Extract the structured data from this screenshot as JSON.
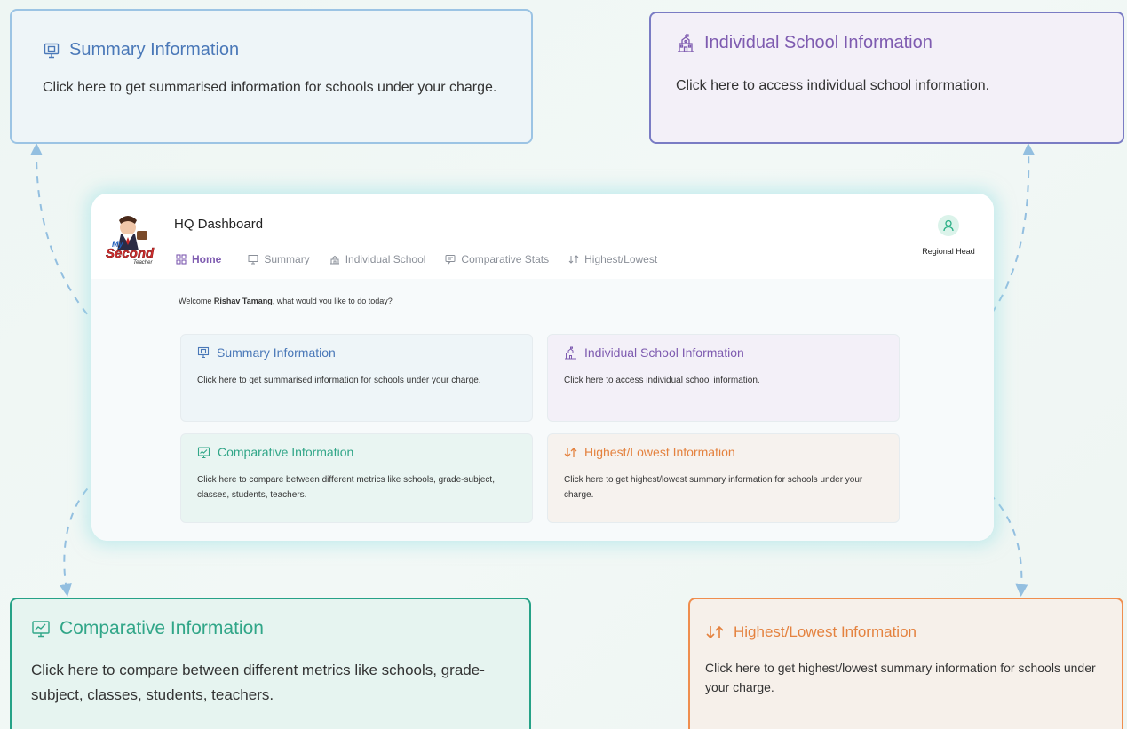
{
  "callouts": {
    "summary": {
      "icon": "monitor-icon",
      "title": "Summary Information",
      "desc": "Click here to get summarised information for schools under your charge."
    },
    "individual": {
      "icon": "school-icon",
      "title": "Individual School Information",
      "desc": "Click here to access individual school information."
    },
    "comparative": {
      "icon": "chart-monitor-icon",
      "title": "Comparative Information",
      "desc": "Click here to compare between different metrics like schools, grade-subject, classes, students, teachers."
    },
    "highlow": {
      "icon": "sort-arrows-icon",
      "title": "Highest/Lowest Information",
      "desc": "Click here to get highest/lowest summary information for schools under your charge."
    }
  },
  "header": {
    "logo_text": "My Second Teacher",
    "title": "HQ Dashboard",
    "role": "Regional Head"
  },
  "nav": [
    {
      "label": "Home",
      "icon": "grid-icon",
      "active": true
    },
    {
      "label": "Summary",
      "icon": "monitor-icon"
    },
    {
      "label": "Individual School",
      "icon": "school-icon"
    },
    {
      "label": "Comparative Stats",
      "icon": "chat-icon"
    },
    {
      "label": "Highest/Lowest",
      "icon": "sort-arrows-icon"
    }
  ],
  "welcome": {
    "prefix": "Welcome ",
    "name": "Rishav Tamang",
    "suffix": ", what would you like to do today?"
  },
  "cards": {
    "summary": {
      "title": "Summary Information",
      "desc": "Click here to get summarised information for schools under your charge."
    },
    "individual": {
      "title": "Individual School Information",
      "desc": "Click here to access individual school information."
    },
    "comparative": {
      "title": "Comparative Information",
      "desc": "Click here to compare between different metrics like schools, grade-subject, classes, students, teachers."
    },
    "highlow": {
      "title": "Highest/Lowest Information",
      "desc": "Click here to get highest/lowest summary information for schools under your charge."
    }
  },
  "colors": {
    "summary": "#4a78b8",
    "individual": "#7e5bb0",
    "comparative": "#31a688",
    "highlow": "#e4823f",
    "connector": "#93bfe0"
  }
}
